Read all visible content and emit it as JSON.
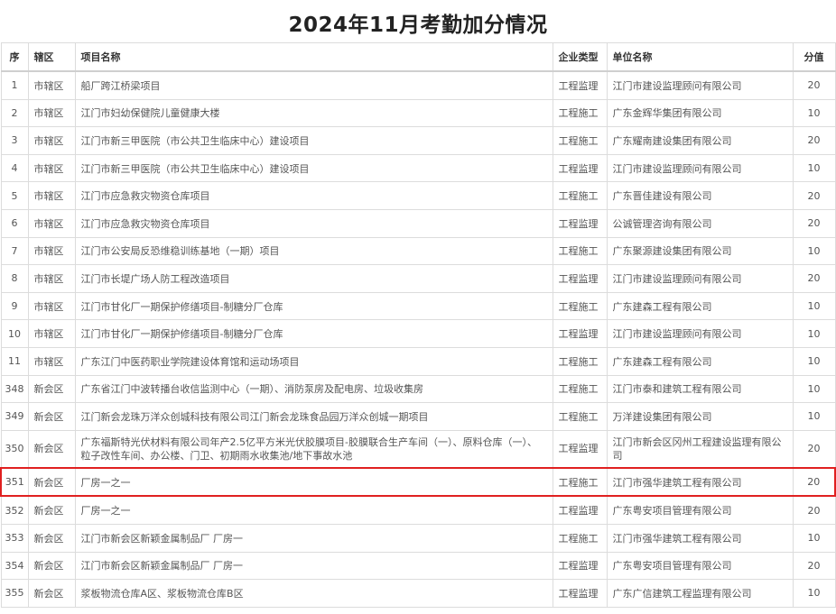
{
  "title": "2024年11月考勤加分情况",
  "columns": {
    "no": "序",
    "district": "辖区",
    "project": "项目名称",
    "type": "企业类型",
    "company": "单位名称",
    "score": "分值"
  },
  "rows": [
    {
      "no": "1",
      "district": "市辖区",
      "project": "船厂跨江桥梁项目",
      "type": "工程监理",
      "company": "江门市建设监理顾问有限公司",
      "score": "20"
    },
    {
      "no": "2",
      "district": "市辖区",
      "project": "江门市妇幼保健院儿童健康大楼",
      "type": "工程施工",
      "company": "广东金辉华集团有限公司",
      "score": "10"
    },
    {
      "no": "3",
      "district": "市辖区",
      "project": "江门市新三甲医院（市公共卫生临床中心）建设项目",
      "type": "工程施工",
      "company": "广东耀南建设集团有限公司",
      "score": "20"
    },
    {
      "no": "4",
      "district": "市辖区",
      "project": "江门市新三甲医院（市公共卫生临床中心）建设项目",
      "type": "工程监理",
      "company": "江门市建设监理顾问有限公司",
      "score": "10"
    },
    {
      "no": "5",
      "district": "市辖区",
      "project": "江门市应急救灾物资仓库项目",
      "type": "工程施工",
      "company": "广东晋佳建设有限公司",
      "score": "20"
    },
    {
      "no": "6",
      "district": "市辖区",
      "project": "江门市应急救灾物资仓库项目",
      "type": "工程监理",
      "company": "公诚管理咨询有限公司",
      "score": "20"
    },
    {
      "no": "7",
      "district": "市辖区",
      "project": "江门市公安局反恐维稳训练基地（一期）项目",
      "type": "工程施工",
      "company": "广东聚源建设集团有限公司",
      "score": "10"
    },
    {
      "no": "8",
      "district": "市辖区",
      "project": "江门市长堤广场人防工程改造项目",
      "type": "工程监理",
      "company": "江门市建设监理顾问有限公司",
      "score": "20"
    },
    {
      "no": "9",
      "district": "市辖区",
      "project": "江门市甘化厂一期保护修缮项目-制糖分厂仓库",
      "type": "工程施工",
      "company": "广东建森工程有限公司",
      "score": "10"
    },
    {
      "no": "10",
      "district": "市辖区",
      "project": "江门市甘化厂一期保护修缮项目-制糖分厂仓库",
      "type": "工程监理",
      "company": "江门市建设监理顾问有限公司",
      "score": "10"
    },
    {
      "no": "11",
      "district": "市辖区",
      "project": "广东江门中医药职业学院建设体育馆和运动场项目",
      "type": "工程施工",
      "company": "广东建森工程有限公司",
      "score": "10"
    },
    {
      "no": "348",
      "district": "新会区",
      "project": "广东省江门中波转播台收信监测中心（一期）、消防泵房及配电房、垃圾收集房",
      "type": "工程施工",
      "company": "江门市泰和建筑工程有限公司",
      "score": "10"
    },
    {
      "no": "349",
      "district": "新会区",
      "project": "江门新会龙珠万洋众创城科技有限公司江门新会龙珠食品园万洋众创城一期项目",
      "type": "工程施工",
      "company": "万洋建设集团有限公司",
      "score": "10"
    },
    {
      "no": "350",
      "district": "新会区",
      "project": "广东福斯特光伏材料有限公司年产2.5亿平方米光伏胶膜项目-胶膜联合生产车间（一）、原料仓库（一）、粒子改性车间、办公楼、门卫、初期雨水收集池/地下事故水池",
      "type": "工程监理",
      "company": "江门市新会区冈州工程建设监理有限公司",
      "score": "20",
      "tall": true
    },
    {
      "no": "351",
      "district": "新会区",
      "project": "厂房一之一",
      "type": "工程施工",
      "company": "江门市强华建筑工程有限公司",
      "score": "20",
      "highlight": true
    },
    {
      "no": "352",
      "district": "新会区",
      "project": "厂房一之一",
      "type": "工程监理",
      "company": "广东粤安项目管理有限公司",
      "score": "20"
    },
    {
      "no": "353",
      "district": "新会区",
      "project": "江门市新会区新颖金属制品厂 厂房一",
      "type": "工程施工",
      "company": "江门市强华建筑工程有限公司",
      "score": "10"
    },
    {
      "no": "354",
      "district": "新会区",
      "project": "江门市新会区新颖金属制品厂 厂房一",
      "type": "工程监理",
      "company": "广东粤安项目管理有限公司",
      "score": "20"
    },
    {
      "no": "355",
      "district": "新会区",
      "project": "浆板物流仓库A区、浆板物流仓库B区",
      "type": "工程监理",
      "company": "广东广信建筑工程监理有限公司",
      "score": "10"
    }
  ]
}
